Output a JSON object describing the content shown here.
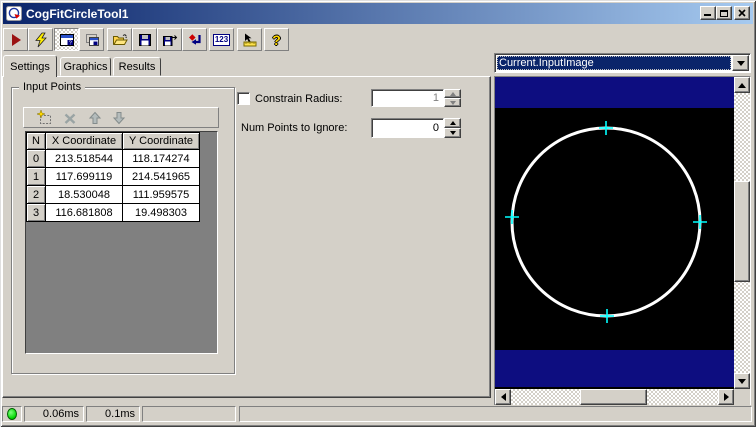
{
  "window": {
    "title": "CogFitCircleTool1"
  },
  "toolbar": {
    "buttons": [
      {
        "name": "run-tool"
      },
      {
        "name": "run-tool-electric"
      },
      {
        "name": "show-tool-display",
        "pressed": true
      },
      {
        "name": "float-tool-display"
      },
      {
        "name": "open-tool"
      },
      {
        "name": "save-tool"
      },
      {
        "name": "save-tool-as"
      },
      {
        "name": "reset-tool"
      },
      {
        "name": "numeric-display"
      },
      {
        "name": "pixel-measure"
      },
      {
        "name": "help"
      }
    ],
    "glyph_123": "123",
    "glyph_help": "?"
  },
  "tabs": [
    {
      "label": "Settings",
      "active": true
    },
    {
      "label": "Graphics",
      "active": false
    },
    {
      "label": "Results",
      "active": false
    }
  ],
  "input_points": {
    "group_label": "Input Points",
    "toolbar_icons": [
      "add-point",
      "delete-point",
      "move-up",
      "move-down"
    ],
    "columns": [
      "N",
      "X Coordinate",
      "Y Coordinate"
    ],
    "rows": [
      [
        "0",
        "213.518544",
        "118.174274"
      ],
      [
        "1",
        "117.699119",
        "214.541965"
      ],
      [
        "2",
        "18.530048",
        "111.959575"
      ],
      [
        "3",
        "116.681808",
        "19.498303"
      ]
    ]
  },
  "settings": {
    "constrain_radius_label": "Constrain Radius:",
    "constrain_radius_value": "1",
    "constrain_radius_checked": false,
    "num_points_to_ignore_label": "Num Points to Ignore:",
    "num_points_to_ignore_value": "0"
  },
  "image_panel": {
    "selected_image": "Current.InputImage",
    "graphic": "white circle fit with 4 cyan point markers on black image with dark blue bands"
  },
  "status_bar": {
    "time_1": "0.06ms",
    "time_2": "0.1ms"
  },
  "colors": {
    "face": "#d4d0c8",
    "title_gradient_left": "#0a246a",
    "title_gradient_right": "#a6caf0",
    "selection": "#0a246a",
    "image_band_blue": "#0d0d80",
    "circle_stroke": "#ffffff",
    "marker_cyan": "#00ffff",
    "status_led_green": "#00d800"
  }
}
